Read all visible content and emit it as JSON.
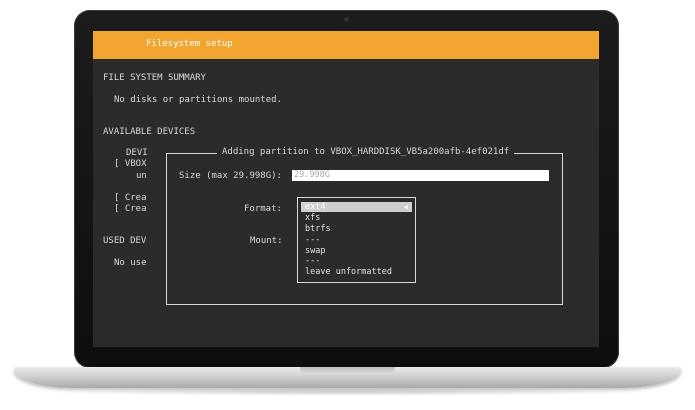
{
  "header": {
    "title": "Filesystem setup"
  },
  "summary": {
    "heading": "FILE SYSTEM SUMMARY",
    "message": "No disks or partitions mounted."
  },
  "available": {
    "heading": "AVAILABLE DEVICES",
    "col_header": "DEVI",
    "rows": [
      "[ VBOX",
      "un",
      "[ Crea",
      "[ Crea"
    ]
  },
  "used": {
    "heading": "USED DEV",
    "message": "No use"
  },
  "dialog": {
    "title": "Adding partition to VBOX_HARDDISK_VB5a200afb-4ef021df",
    "size_label": "Size (max 29.998G):",
    "size_placeholder": "29.998G",
    "format_label": "Format:",
    "mount_label": "Mount:"
  },
  "format_menu": {
    "options": [
      "ext4",
      "xfs",
      "btrfs",
      "---",
      "swap",
      "---",
      "leave unformatted"
    ],
    "selected": "ext4",
    "caret": "◀"
  },
  "colors": {
    "header": "#f2a531",
    "screen_bg": "#2b2b2b",
    "text": "#d8d8d8"
  }
}
